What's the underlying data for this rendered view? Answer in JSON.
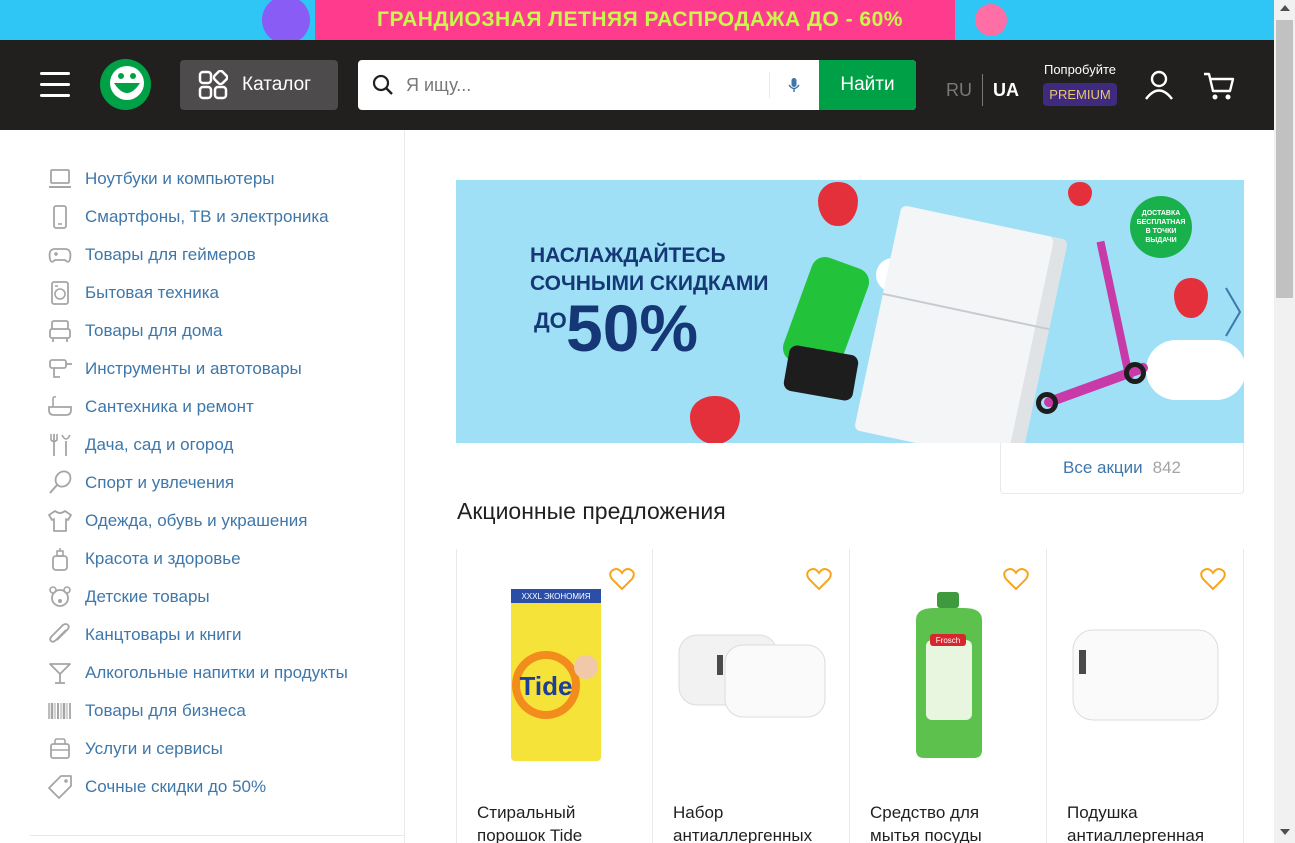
{
  "promo_strip": {
    "text": "ГРАНДИОЗНАЯ ЛЕТНЯЯ РАСПРОДАЖА ДО - 60%"
  },
  "header": {
    "catalog_label": "Каталог",
    "search_placeholder": "Я ищу...",
    "search_button": "Найти",
    "lang_ru": "RU",
    "lang_ua": "UA",
    "premium_try": "Попробуйте",
    "premium_badge": "PREMIUM"
  },
  "sidebar": {
    "items": [
      {
        "label": "Ноутбуки и компьютеры",
        "icon": "laptop-icon"
      },
      {
        "label": "Смартфоны, ТВ и электроника",
        "icon": "smartphone-icon"
      },
      {
        "label": "Товары для геймеров",
        "icon": "gamepad-icon"
      },
      {
        "label": "Бытовая техника",
        "icon": "washing-machine-icon"
      },
      {
        "label": "Товары для дома",
        "icon": "armchair-icon"
      },
      {
        "label": "Инструменты и автотовары",
        "icon": "drill-icon"
      },
      {
        "label": "Сантехника и ремонт",
        "icon": "bathtub-icon"
      },
      {
        "label": "Дача, сад и огород",
        "icon": "garden-tools-icon"
      },
      {
        "label": "Спорт и увлечения",
        "icon": "racket-icon"
      },
      {
        "label": "Одежда, обувь и украшения",
        "icon": "tshirt-icon"
      },
      {
        "label": "Красота и здоровье",
        "icon": "perfume-icon"
      },
      {
        "label": "Детские товары",
        "icon": "teddy-bear-icon"
      },
      {
        "label": "Канцтовары и книги",
        "icon": "paperclip-icon"
      },
      {
        "label": "Алкогольные напитки и продукты",
        "icon": "cocktail-icon"
      },
      {
        "label": "Товары для бизнеса",
        "icon": "barcode-icon"
      },
      {
        "label": "Услуги и сервисы",
        "icon": "services-icon"
      },
      {
        "label": "Сочные скидки до 50%",
        "icon": "tag-icon"
      }
    ]
  },
  "banner": {
    "line1": "НАСЛАЖДАЙТЕСЬ",
    "line2": "СОЧНЫМИ СКИДКАМИ",
    "do": "ДО",
    "percent": "50%",
    "delivery_badge": "ДОСТАВКА БЕСПЛАТНАЯ В ТОЧКИ ВЫДАЧИ"
  },
  "all_actions": {
    "label": "Все акции",
    "count": "842"
  },
  "section_title": "Акционные предложения",
  "products": [
    {
      "title": "Стиральный порошок Tide",
      "image": "detergent-box",
      "pack_label": "XXXL ЭКОНОМИЯ",
      "brand": "Tide"
    },
    {
      "title": "Набор антиаллергенных",
      "image": "pillows-pair"
    },
    {
      "title": "Средство для мытья посуды",
      "image": "dish-soap-bottle",
      "brand": "Frosch"
    },
    {
      "title": "Подушка антиаллергенная",
      "image": "pillow-single"
    }
  ],
  "colors": {
    "header_bg": "#221f1f",
    "accent_green": "#00a046",
    "link_blue": "#3e77aa",
    "heart_orange": "#f8a51b"
  }
}
